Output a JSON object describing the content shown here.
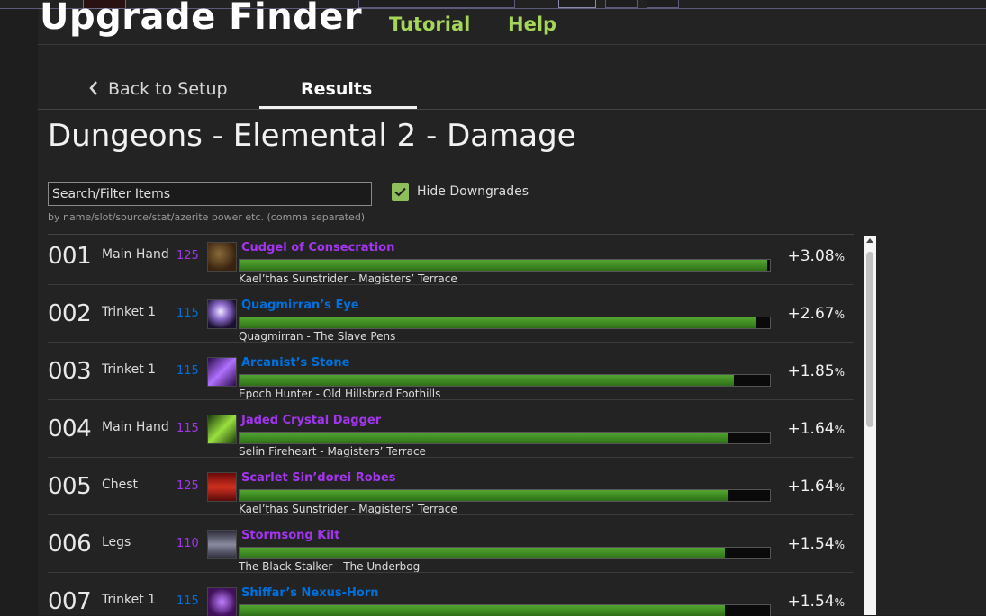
{
  "header": {
    "title": "Upgrade Finder",
    "links": [
      "Tutorial",
      "Help"
    ]
  },
  "tabs": {
    "back": "Back to Setup",
    "results": "Results"
  },
  "page_title": "Dungeons - Elemental 2 - Damage",
  "filter": {
    "placeholder": "Search/Filter Items",
    "hint": "by name/slot/source/stat/azerite power etc. (comma separated)"
  },
  "hide_downgrades": {
    "label": "Hide Downgrades",
    "checked": true
  },
  "colors": {
    "epic": "#a335ee",
    "rare": "#0070dd",
    "nav_link": "#a5d65a",
    "bar": "#3e8a22"
  },
  "results": [
    {
      "rank": "001",
      "slot": "Main Hand",
      "ilvl": "125",
      "quality": "epic",
      "name": "Cudgel of Consecration",
      "source": "Kael’thas Sunstrider - Magisters’ Terrace",
      "pct": "+3.08",
      "fill": 0.995,
      "icon": "mace-icon"
    },
    {
      "rank": "002",
      "slot": "Trinket 1",
      "ilvl": "115",
      "quality": "rare",
      "name": "Quagmirran’s Eye",
      "source": "Quagmirran - The Slave Pens",
      "pct": "+2.67",
      "fill": 0.974,
      "icon": "orb-icon"
    },
    {
      "rank": "003",
      "slot": "Trinket 1",
      "ilvl": "115",
      "quality": "rare",
      "name": "Arcanist’s Stone",
      "source": "Epoch Hunter - Old Hillsbrad Foothills",
      "pct": "+1.85",
      "fill": 0.932,
      "icon": "crystal-icon"
    },
    {
      "rank": "004",
      "slot": "Main Hand",
      "ilvl": "115",
      "quality": "epic",
      "name": "Jaded Crystal Dagger",
      "source": "Selin Fireheart - Magisters’ Terrace",
      "pct": "+1.64",
      "fill": 0.92,
      "icon": "dagger-icon"
    },
    {
      "rank": "005",
      "slot": "Chest",
      "ilvl": "125",
      "quality": "epic",
      "name": "Scarlet Sin’dorei Robes",
      "source": "Kael’thas Sunstrider - Magisters’ Terrace",
      "pct": "+1.64",
      "fill": 0.92,
      "icon": "robe-icon"
    },
    {
      "rank": "006",
      "slot": "Legs",
      "ilvl": "110",
      "quality": "epic",
      "name": "Stormsong Kilt",
      "source": "The Black Stalker - The Underbog",
      "pct": "+1.54",
      "fill": 0.915,
      "icon": "kilt-icon"
    },
    {
      "rank": "007",
      "slot": "Trinket 1",
      "ilvl": "115",
      "quality": "rare",
      "name": "Shiffar’s Nexus-Horn",
      "source": "",
      "pct": "+1.54",
      "fill": 0.915,
      "icon": "horn-icon"
    }
  ],
  "percent_symbol": "%"
}
